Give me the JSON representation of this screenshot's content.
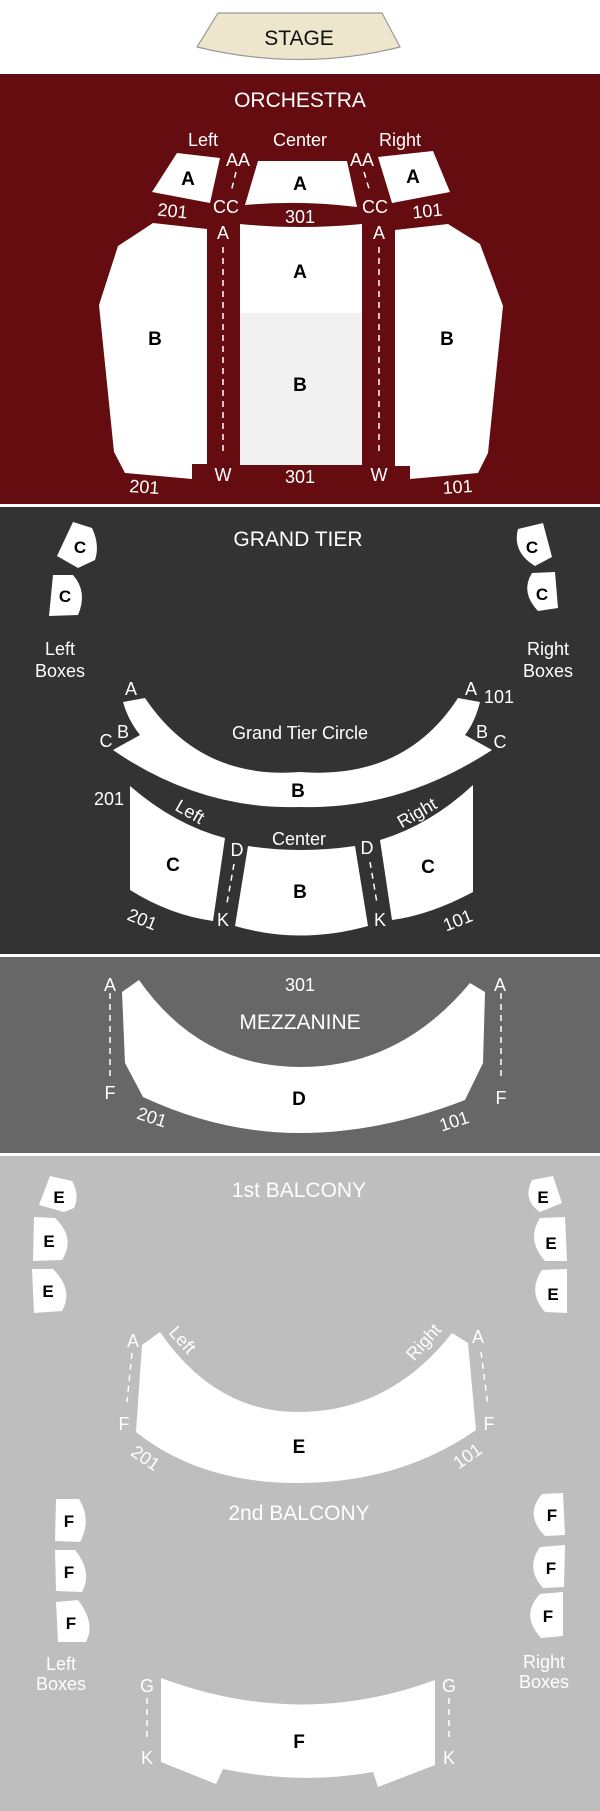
{
  "stage": {
    "label": "STAGE",
    "color": "#ede6cc"
  },
  "levels": {
    "orchestra": {
      "title": "ORCHESTRA",
      "color": "#650c10",
      "area_labels": {
        "left": "Left",
        "center": "Center",
        "right": "Right"
      },
      "sections": {
        "left_front": "A",
        "center_front": "A",
        "right_front": "A",
        "left_rear": "B",
        "center_a": "A",
        "center_b": "B",
        "right_rear": "B"
      },
      "row_labels": {
        "aa": "AA",
        "cc": "CC",
        "a": "A",
        "w": "W"
      },
      "seat_numbers": {
        "left": "201",
        "center": "301",
        "right": "101"
      }
    },
    "grand_tier": {
      "title": "GRAND TIER",
      "color": "#333333",
      "left_boxes": {
        "label_line1": "Left",
        "label_line2": "Boxes",
        "sections": [
          "C",
          "C"
        ]
      },
      "right_boxes": {
        "label_line1": "Right",
        "label_line2": "Boxes",
        "sections": [
          "C",
          "C"
        ]
      },
      "circle": {
        "title": "Grand Tier Circle",
        "section": "B"
      },
      "area_labels": {
        "left": "Left",
        "center": "Center",
        "right": "Right"
      },
      "sections": {
        "left": "C",
        "center": "B",
        "right": "C"
      },
      "row_labels": {
        "a": "A",
        "b": "B",
        "c": "C",
        "d": "D",
        "k": "K"
      },
      "seat_numbers": {
        "left": "201",
        "right": "101"
      }
    },
    "mezzanine": {
      "title": "MEZZANINE",
      "color": "#676767",
      "section": "D",
      "row_labels": {
        "a": "A",
        "f": "F"
      },
      "seat_numbers": {
        "left": "201",
        "center": "301",
        "right": "101"
      }
    },
    "first_balcony": {
      "title": "1st BALCONY",
      "color": "#bebebe",
      "left_boxes": {
        "sections": [
          "E",
          "E",
          "E"
        ]
      },
      "right_boxes": {
        "sections": [
          "E",
          "E",
          "E"
        ]
      },
      "section": "E",
      "area_labels": {
        "left": "Left",
        "right": "Right"
      },
      "row_labels": {
        "a": "A",
        "f": "F"
      },
      "seat_numbers": {
        "left": "201",
        "right": "101"
      }
    },
    "second_balcony": {
      "title": "2nd BALCONY",
      "color": "#bebebe",
      "left_boxes": {
        "label_line1": "Left",
        "label_line2": "Boxes",
        "sections": [
          "F",
          "F",
          "F"
        ]
      },
      "right_boxes": {
        "label_line1": "Right",
        "label_line2": "Boxes",
        "sections": [
          "F",
          "F",
          "F"
        ]
      },
      "section": "F",
      "row_labels": {
        "g": "G",
        "k": "K"
      }
    }
  }
}
